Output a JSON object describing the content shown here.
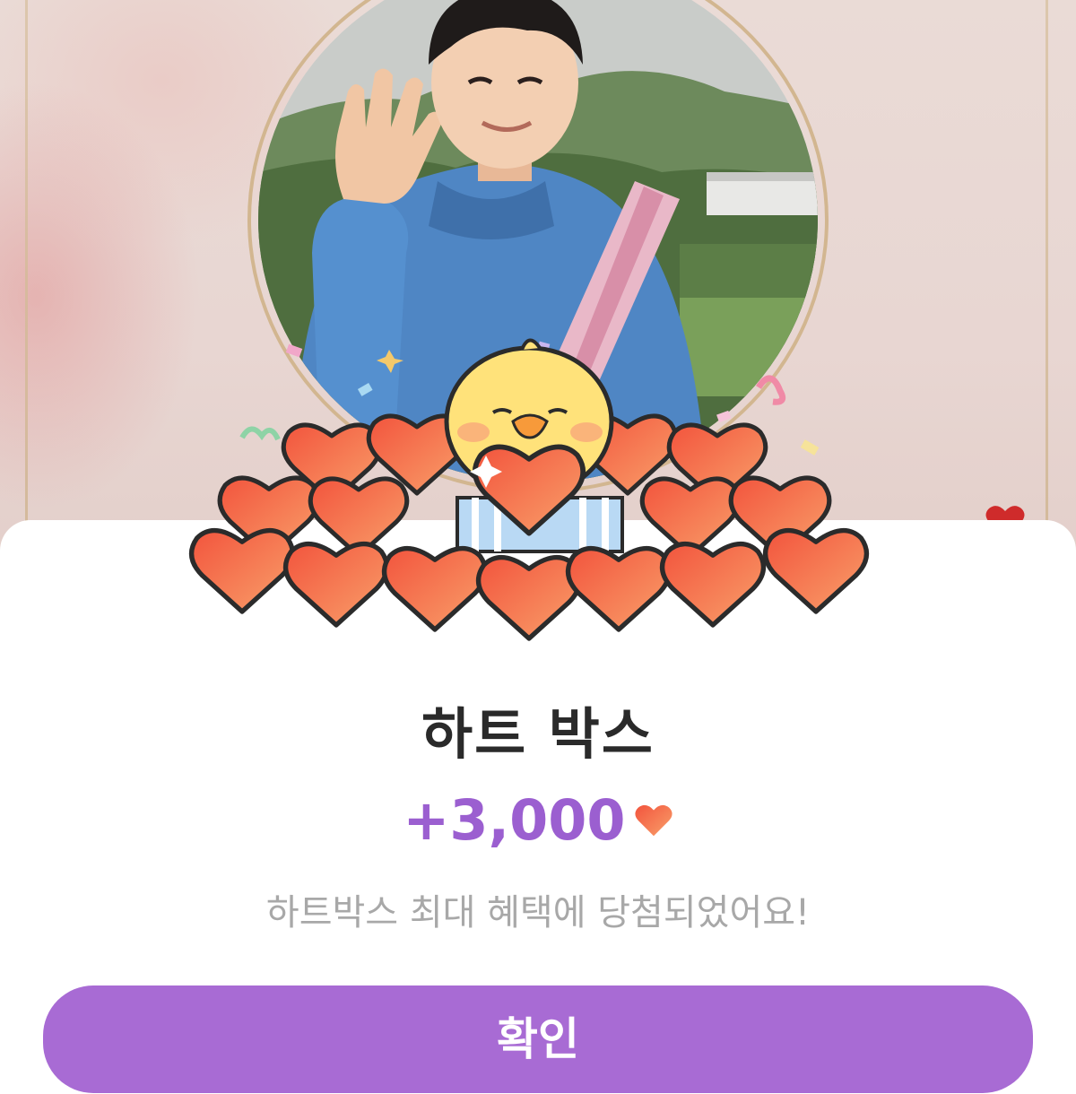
{
  "reward": {
    "title": "하트 박스",
    "amount": "+3,000",
    "amount_icon": "heart-icon",
    "message": "하트박스 최대 혜택에 당첨되었어요!",
    "confirm_label": "확인"
  },
  "background": {
    "photo_description_icon": "profile-photo",
    "decoration_icon": "heart-icon"
  },
  "colors": {
    "accent_purple": "#a86bd4",
    "amount_purple": "#9b5fd0",
    "title_text": "#2a2a2a",
    "message_text": "#a8a8a8",
    "heart_red": "#f2543d",
    "heart_orange": "#f88a5a",
    "chick_yellow": "#ffe27a",
    "frame_gold": "#d2b690"
  }
}
